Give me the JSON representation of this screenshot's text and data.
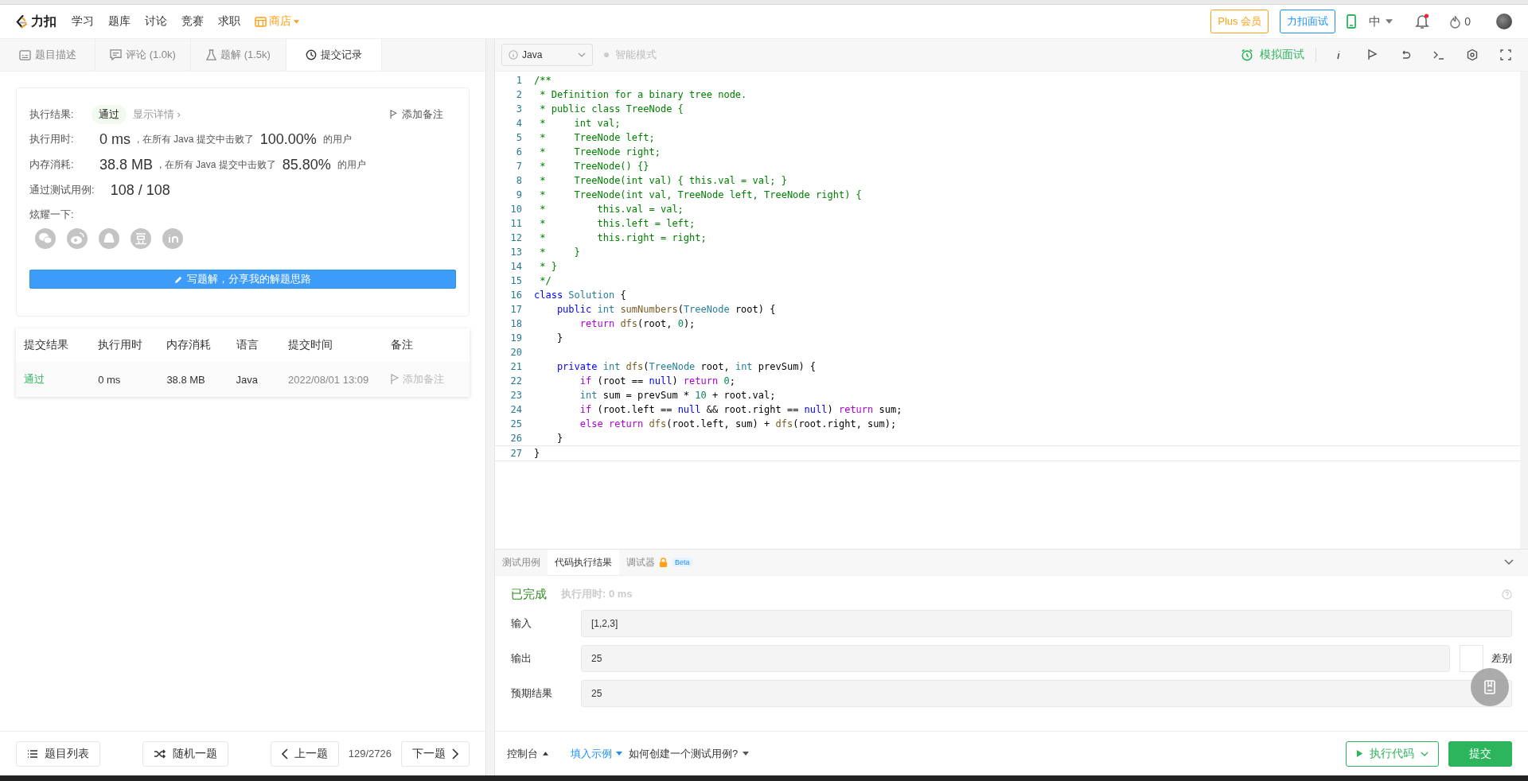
{
  "nav": {
    "logo": "力扣",
    "items": [
      "学习",
      "题库",
      "讨论",
      "竞赛",
      "求职"
    ],
    "store": "商店",
    "plus": "Plus 会员",
    "interview": "力扣面试",
    "lang": "中",
    "notification_dot": true,
    "streak": "0"
  },
  "left_tabs": [
    {
      "label": "题目描述",
      "selected": false
    },
    {
      "label": "评论 (1.0k)",
      "selected": false
    },
    {
      "label": "题解 (1.5k)",
      "selected": false
    },
    {
      "label": "提交记录",
      "selected": true
    }
  ],
  "result": {
    "status_label": "执行结果:",
    "status": "通过",
    "details": "显示详情 ›",
    "add_note": "添加备注",
    "rows": [
      {
        "label": "执行用时:",
        "value": "0 ms",
        "mid": ", 在所有 Java 提交中击败了",
        "pct": "100.00%",
        "tail": "的用户"
      },
      {
        "label": "内存消耗:",
        "value": "38.8 MB",
        "mid": ", 在所有 Java 提交中击败了",
        "pct": "85.80%",
        "tail": "的用户"
      }
    ],
    "cases_label": "通过测试用例:",
    "cases": "108 / 108",
    "share_label": "炫耀一下:",
    "write_button": "写题解，分享我的解题思路"
  },
  "submissions": {
    "columns": [
      "提交结果",
      "执行用时",
      "内存消耗",
      "语言",
      "提交时间",
      "备注"
    ],
    "rows": [
      {
        "status": "通过",
        "time": "0 ms",
        "memory": "38.8 MB",
        "language": "Java",
        "submitted": "2022/08/01 13:09",
        "note": "添加备注"
      }
    ]
  },
  "left_footer": {
    "list": "题目列表",
    "random": "随机一题",
    "prev": "上一题",
    "counter": "129/2726",
    "next": "下一题"
  },
  "editor_bar": {
    "language": "Java",
    "smart_mode": {
      "label": "智能模式",
      "on": false
    },
    "mock": "模拟面试"
  },
  "code": [
    {
      "n": "1",
      "tokens": [
        {
          "kind": "comment",
          "text": "/**"
        }
      ]
    },
    {
      "n": "2",
      "tokens": [
        {
          "kind": "comment",
          "text": " * Definition for a binary tree node."
        }
      ]
    },
    {
      "n": "3",
      "tokens": [
        {
          "kind": "comment",
          "text": " * public class TreeNode {"
        }
      ]
    },
    {
      "n": "4",
      "tokens": [
        {
          "kind": "comment",
          "text": " *     int val;"
        }
      ]
    },
    {
      "n": "5",
      "tokens": [
        {
          "kind": "comment",
          "text": " *     TreeNode left;"
        }
      ]
    },
    {
      "n": "6",
      "tokens": [
        {
          "kind": "comment",
          "text": " *     TreeNode right;"
        }
      ]
    },
    {
      "n": "7",
      "tokens": [
        {
          "kind": "comment",
          "text": " *     TreeNode() {}"
        }
      ]
    },
    {
      "n": "8",
      "tokens": [
        {
          "kind": "comment",
          "text": " *     TreeNode(int val) { this.val = val; }"
        }
      ]
    },
    {
      "n": "9",
      "tokens": [
        {
          "kind": "comment",
          "text": " *     TreeNode(int val, TreeNode left, TreeNode right) {"
        }
      ]
    },
    {
      "n": "10",
      "tokens": [
        {
          "kind": "comment",
          "text": " *         this.val = val;"
        }
      ]
    },
    {
      "n": "11",
      "tokens": [
        {
          "kind": "comment",
          "text": " *         this.left = left;"
        }
      ]
    },
    {
      "n": "12",
      "tokens": [
        {
          "kind": "comment",
          "text": " *         this.right = right;"
        }
      ]
    },
    {
      "n": "13",
      "tokens": [
        {
          "kind": "comment",
          "text": " *     }"
        }
      ]
    },
    {
      "n": "14",
      "tokens": [
        {
          "kind": "comment",
          "text": " * }"
        }
      ]
    },
    {
      "n": "15",
      "tokens": [
        {
          "kind": "comment",
          "text": " */"
        }
      ]
    },
    {
      "n": "16",
      "tokens": [
        {
          "kind": "keyword",
          "text": "class"
        },
        {
          "kind": "type",
          "text": " Solution"
        },
        {
          "kind": "plain",
          "text": " {"
        }
      ]
    },
    {
      "n": "17",
      "tokens": [
        {
          "kind": "keyword",
          "text": "    public"
        },
        {
          "kind": "type",
          "text": " int"
        },
        {
          "kind": "function",
          "text": " sumNumbers"
        },
        {
          "kind": "plain",
          "text": "("
        },
        {
          "kind": "type",
          "text": "TreeNode"
        },
        {
          "kind": "plain",
          "text": " root) {"
        }
      ]
    },
    {
      "n": "18",
      "tokens": [
        {
          "kind": "control",
          "text": "        return"
        },
        {
          "kind": "function",
          "text": " dfs"
        },
        {
          "kind": "plain",
          "text": "(root, "
        },
        {
          "kind": "number",
          "text": "0"
        },
        {
          "kind": "plain",
          "text": ");"
        }
      ]
    },
    {
      "n": "19",
      "tokens": [
        {
          "kind": "plain",
          "text": "    }"
        }
      ]
    },
    {
      "n": "20"
    },
    {
      "n": "21",
      "tokens": [
        {
          "kind": "keyword",
          "text": "    private"
        },
        {
          "kind": "type",
          "text": " int"
        },
        {
          "kind": "function",
          "text": " dfs"
        },
        {
          "kind": "plain",
          "text": "("
        },
        {
          "kind": "type",
          "text": "TreeNode"
        },
        {
          "kind": "plain",
          "text": " root, "
        },
        {
          "kind": "type",
          "text": "int"
        },
        {
          "kind": "plain",
          "text": " prevSum) {"
        }
      ]
    },
    {
      "n": "22",
      "tokens": [
        {
          "kind": "control",
          "text": "        if"
        },
        {
          "kind": "plain",
          "text": " (root == "
        },
        {
          "kind": "keyword",
          "text": "null"
        },
        {
          "kind": "plain",
          "text": ") "
        },
        {
          "kind": "control",
          "text": "return"
        },
        {
          "kind": "number",
          "text": " 0"
        },
        {
          "kind": "plain",
          "text": ";"
        }
      ]
    },
    {
      "n": "23",
      "tokens": [
        {
          "kind": "type",
          "text": "        int"
        },
        {
          "kind": "plain",
          "text": " sum = prevSum * "
        },
        {
          "kind": "number",
          "text": "10"
        },
        {
          "kind": "plain",
          "text": " + root.val;"
        }
      ]
    },
    {
      "n": "24",
      "tokens": [
        {
          "kind": "control",
          "text": "        if"
        },
        {
          "kind": "plain",
          "text": " (root.left == "
        },
        {
          "kind": "keyword",
          "text": "null"
        },
        {
          "kind": "plain",
          "text": " && root.right == "
        },
        {
          "kind": "keyword",
          "text": "null"
        },
        {
          "kind": "plain",
          "text": ") "
        },
        {
          "kind": "control",
          "text": "return"
        },
        {
          "kind": "plain",
          "text": " sum;"
        }
      ]
    },
    {
      "n": "25",
      "tokens": [
        {
          "kind": "control",
          "text": "        else"
        },
        {
          "kind": "control",
          "text": " return"
        },
        {
          "kind": "function",
          "text": " dfs"
        },
        {
          "kind": "plain",
          "text": "(root.left, sum) + "
        },
        {
          "kind": "function",
          "text": "dfs"
        },
        {
          "kind": "plain",
          "text": "(root.right, sum);"
        }
      ]
    },
    {
      "n": "26",
      "tokens": [
        {
          "kind": "plain",
          "text": "    }"
        }
      ]
    },
    {
      "n": "27",
      "tokens": [
        {
          "kind": "plain",
          "text": "}"
        }
      ]
    }
  ],
  "console": {
    "tabs": [
      {
        "label": "测试用例",
        "selected": false
      },
      {
        "label": "代码执行结果",
        "selected": true
      },
      {
        "label": "调试器",
        "selected": false,
        "locked": true,
        "badge": "Beta"
      }
    ],
    "status": "已完成",
    "runtime": "执行用时: 0 ms",
    "fields": [
      {
        "label": "输入",
        "value": "[1,2,3]"
      },
      {
        "label": "输出",
        "value": "25",
        "diff": {
          "label": "差别",
          "on": false
        }
      },
      {
        "label": "预期结果",
        "value": "25"
      }
    ]
  },
  "right_footer": {
    "console": "控制台",
    "fill_example": "填入示例",
    "how_to": "如何创建一个测试用例?",
    "run": "执行代码",
    "submit": "提交"
  }
}
